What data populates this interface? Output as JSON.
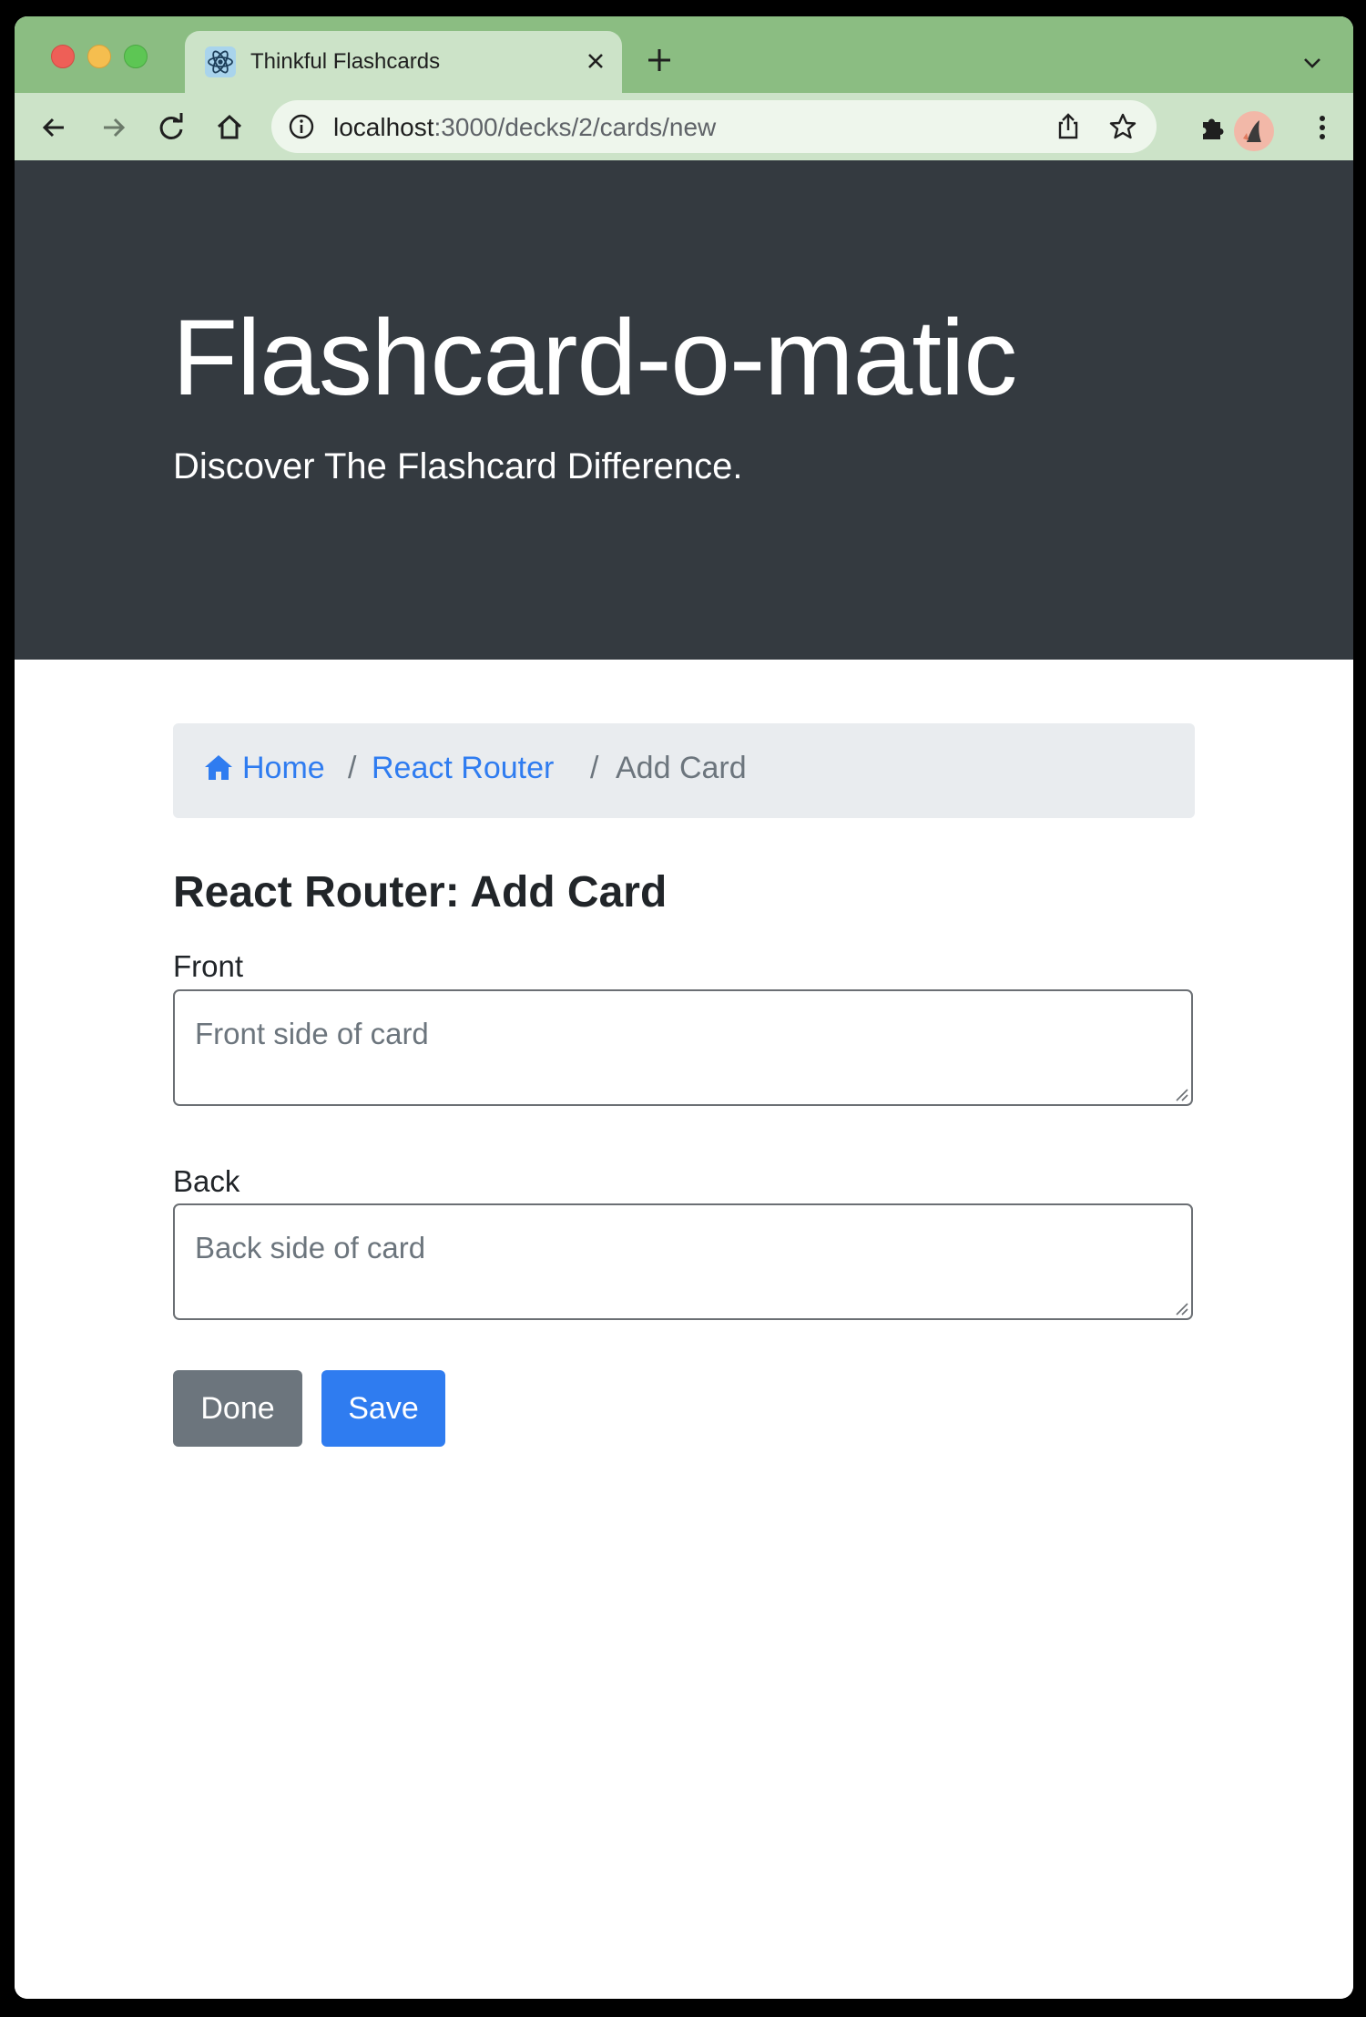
{
  "browser": {
    "tab_title": "Thinkful Flashcards",
    "url_host": "localhost",
    "url_rest": ":3000/decks/2/cards/new",
    "tab_favicon_icon": "react-atom-icon",
    "toolbar_icons": [
      "back-arrow-icon",
      "forward-arrow-icon",
      "reload-icon",
      "home-icon",
      "info-icon",
      "share-icon",
      "star-icon",
      "extensions-icon",
      "profile-avatar",
      "kebab-menu-icon"
    ],
    "accent_color": "#8bbd82"
  },
  "header": {
    "title": "Flashcard-o-matic",
    "lead": "Discover The Flashcard Difference."
  },
  "breadcrumb": {
    "home": "Home",
    "separator": "/",
    "deck": "React Router",
    "current": "Add Card"
  },
  "form": {
    "title": "React Router: Add Card",
    "front_label": "Front",
    "front_placeholder": "Front side of card",
    "front_value": "",
    "back_label": "Back",
    "back_placeholder": "Back side of card",
    "back_value": "",
    "done_label": "Done",
    "save_label": "Save"
  },
  "colors": {
    "jumbotron_bg": "#343a40",
    "primary": "#2f7cf0",
    "secondary": "#6c757d"
  }
}
